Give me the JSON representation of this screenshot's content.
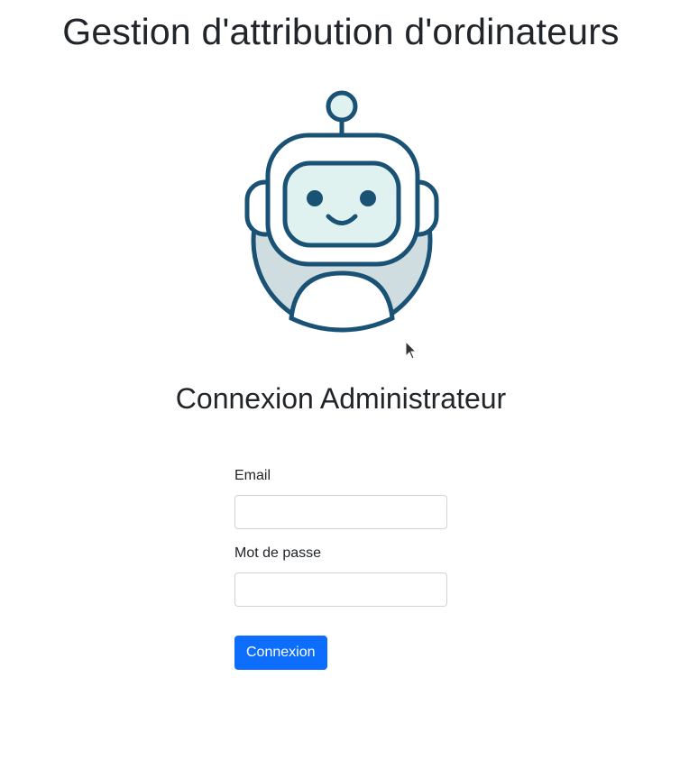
{
  "header": {
    "title": "Gestion d'attribution d'ordinateurs"
  },
  "logo": {
    "icon": "robot-icon",
    "colors": {
      "outline": "#1a5276",
      "face": "#e0f2f0",
      "body": "#cfdce0"
    }
  },
  "login": {
    "title": "Connexion Administrateur",
    "email_label": "Email",
    "email_value": "",
    "email_placeholder": "",
    "password_label": "Mot de passe",
    "password_value": "",
    "password_placeholder": "",
    "submit_label": "Connexion"
  },
  "colors": {
    "primary_button": "#0d6efd",
    "text": "#212529",
    "input_border": "#ced4da"
  }
}
